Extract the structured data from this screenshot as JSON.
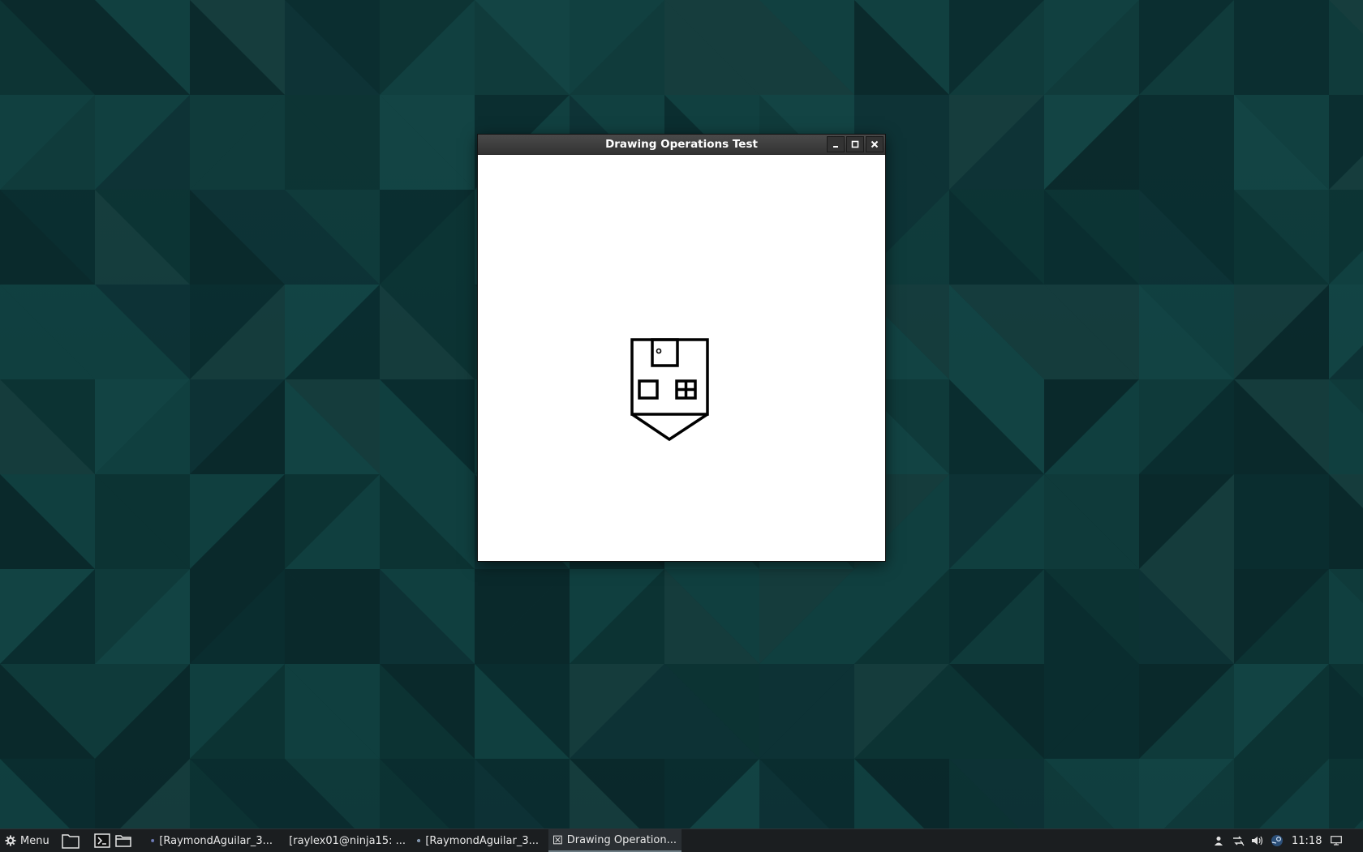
{
  "window": {
    "title": "Drawing Operations Test",
    "controls": [
      "minimize-icon",
      "maximize-icon",
      "close-icon"
    ]
  },
  "taskbar": {
    "menu_label": "Menu",
    "launchers": [
      "files-icon",
      "terminal-icon",
      "folder-icon"
    ],
    "tasks": [
      {
        "label": "[RaymondAguilar_3...",
        "icon": "app-globe-icon"
      },
      {
        "label": "[raylex01@ninja15: ...",
        "icon": "terminal-icon"
      },
      {
        "label": "[RaymondAguilar_3...",
        "icon": "package-icon"
      },
      {
        "label": "Drawing Operation...",
        "icon": "window-app-icon"
      }
    ],
    "tray": [
      "user-icon",
      "network-icon",
      "volume-icon",
      "steam-icon"
    ],
    "clock": "11:18",
    "show_desktop": "show-desktop-icon"
  },
  "colors": {
    "desktop_bg": "#0d3434",
    "taskbar_bg": "#1b1e20",
    "titlebar_bg": "#3b3b3b"
  }
}
